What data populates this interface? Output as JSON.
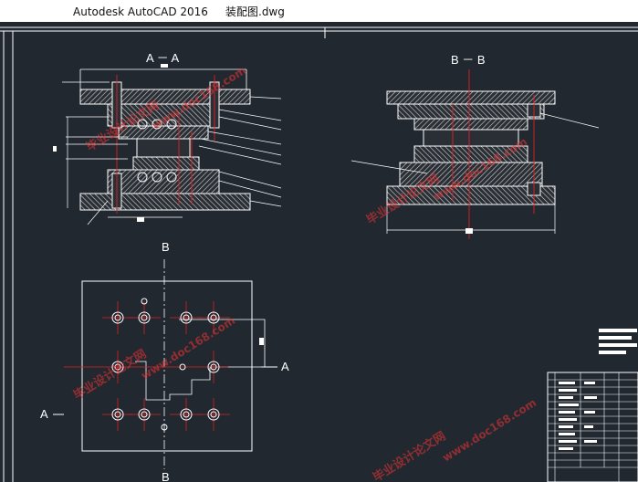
{
  "window": {
    "app_name": "Autodesk AutoCAD 2016",
    "file_name": "装配图.dwg"
  },
  "drawing": {
    "section_aa_label": "A － A",
    "section_bb_label": "B － B",
    "plan_marker_b_top": "B",
    "plan_marker_b_bottom": "B",
    "plan_marker_a_left": "A",
    "plan_marker_a_right": "A",
    "watermark_brand": "毕业设计论文网",
    "watermark_url": "www.doc168.com"
  },
  "colors": {
    "background": "#212830",
    "line": "#ffffff",
    "center_line": "#e02020",
    "hatch": "#cfcfcf"
  }
}
